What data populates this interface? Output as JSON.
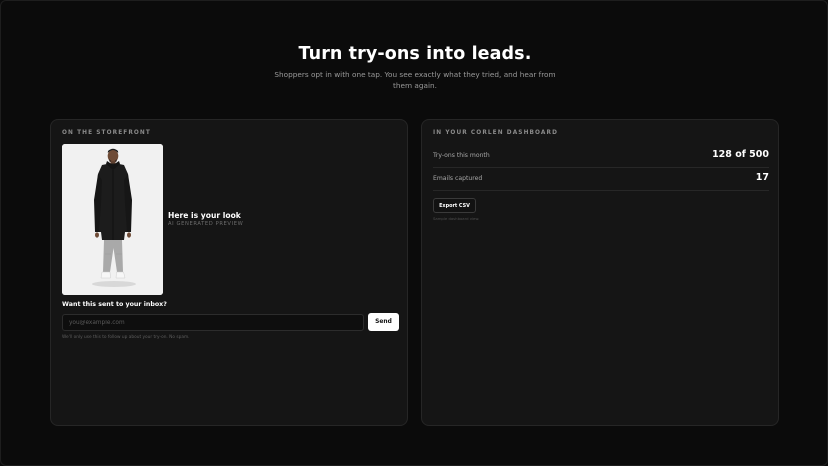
{
  "hero": {
    "title": "Turn try-ons into leads.",
    "subtitle": "Shoppers opt in with one tap. You see exactly what they tried, and hear from them again."
  },
  "storefront": {
    "label": "ON THE STOREFRONT",
    "look_title": "Here is your look",
    "look_tag": "AI GENERATED PREVIEW",
    "inbox_question": "Want this sent to your inbox?",
    "email": {
      "placeholder": "you@example.com",
      "value": ""
    },
    "send_label": "Send",
    "consent_text": "We'll only use this to follow up about your try-on. No spam."
  },
  "dashboard": {
    "label": "IN YOUR CORLEN DASHBOARD",
    "stats": [
      {
        "label": "Try-ons this month",
        "value": "128 of 500"
      },
      {
        "label": "Emails captured",
        "value": "17"
      }
    ],
    "export_label": "Export CSV",
    "note": "Sample dashboard view."
  },
  "colors": {
    "background": "#0b0b0b",
    "panel": "#151515",
    "accent_button": "#ffffff"
  }
}
